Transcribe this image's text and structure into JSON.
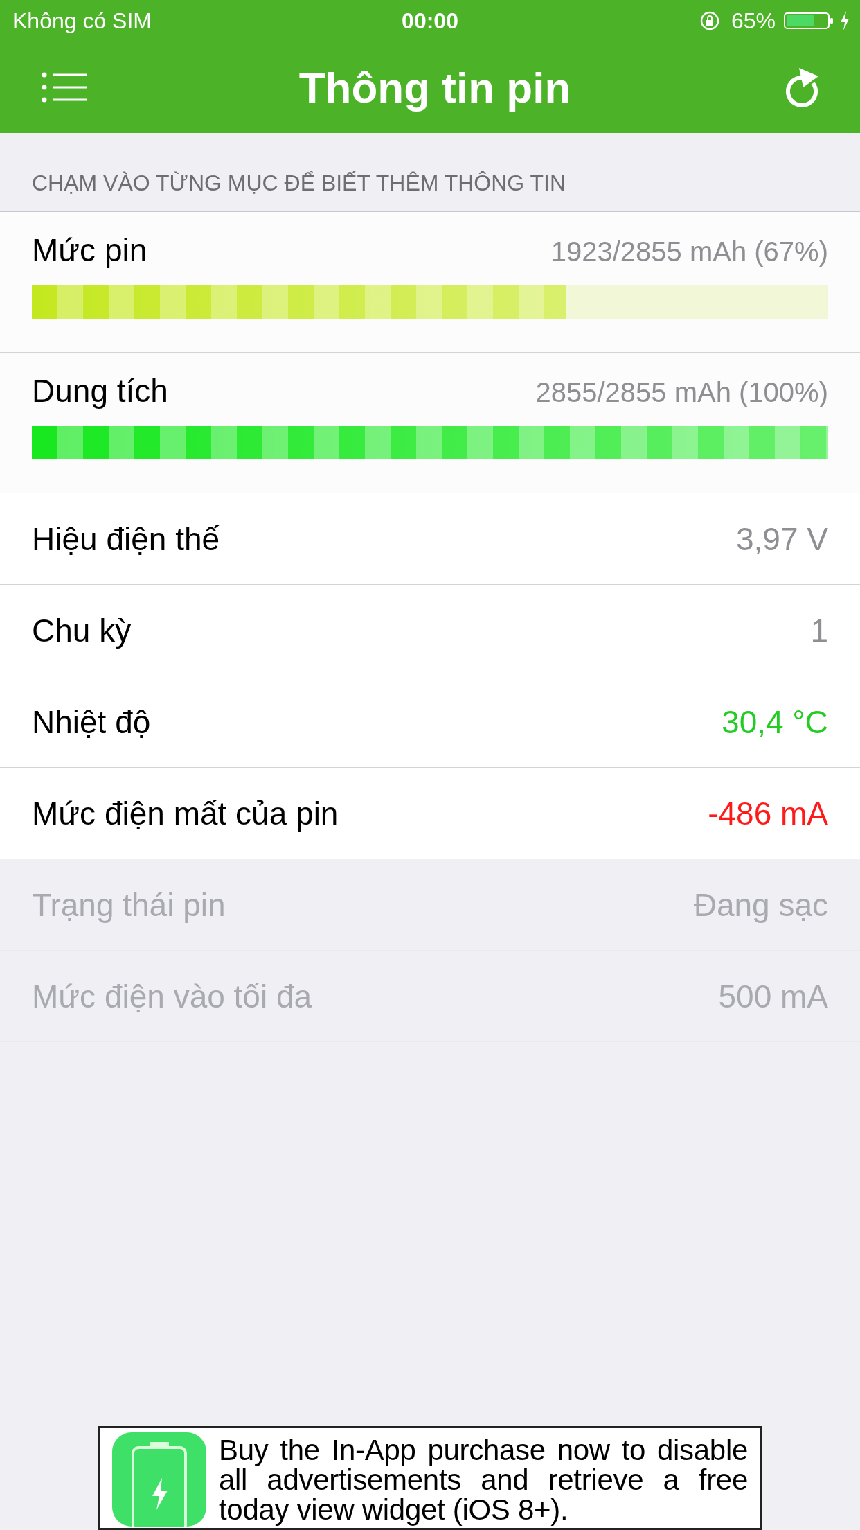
{
  "status_bar": {
    "carrier": "Không có SIM",
    "time": "00:00",
    "battery_percent": "65%"
  },
  "nav": {
    "title": "Thông tin pin"
  },
  "section_header": "CHẠM VÀO TỪNG MỤC ĐỂ BIẾT THÊM THÔNG TIN",
  "rows": [
    {
      "kind": "bar",
      "label": "Mức pin",
      "value": "1923/2855 mAh (67%)",
      "level": 0.67,
      "color": "#c4e81f",
      "disabled": false
    },
    {
      "kind": "bar",
      "label": "Dung tích",
      "value": "2855/2855 mAh (100%)",
      "level": 1,
      "color": "#17e81f",
      "disabled": false
    },
    {
      "kind": "value",
      "label": "Hiệu điện thế",
      "value": "3,97 V",
      "color": "#8e8e93",
      "disabled": false
    },
    {
      "kind": "value",
      "label": "Chu kỳ",
      "value": "1",
      "color": "#8e8e93",
      "disabled": false
    },
    {
      "kind": "value",
      "label": "Nhiệt độ",
      "value": "30,4 °C",
      "color": "#22cc22",
      "disabled": false
    },
    {
      "kind": "value",
      "label": "Mức điện mất của pin",
      "value": "-486 mA",
      "color": "#ff1a1a",
      "disabled": false
    },
    {
      "kind": "value",
      "label": "Trạng thái pin",
      "value": "Đang sạc",
      "color": "#a9a9b0",
      "disabled": true
    },
    {
      "kind": "value",
      "label": "Mức điện vào tối đa",
      "value": "500 mA",
      "color": "#a9a9b0",
      "disabled": true
    }
  ],
  "ad_banner": {
    "text": "Buy the In-App purchase now to disable all advertisements and retrieve a free today view widget (iOS 8+)."
  }
}
